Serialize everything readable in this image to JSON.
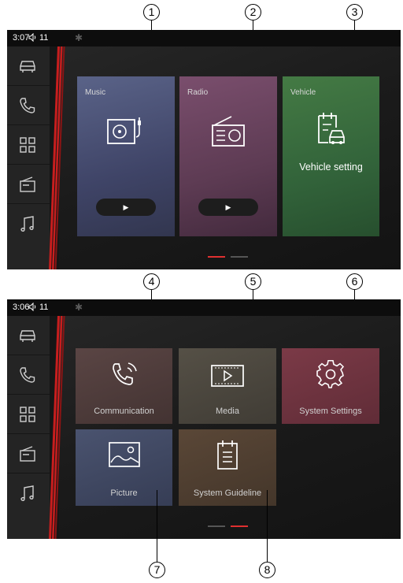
{
  "colors": {
    "accent_red": "#e03030",
    "inactive_dot": "#555555"
  },
  "callouts": [
    "1",
    "2",
    "3",
    "4",
    "5",
    "6",
    "7",
    "8"
  ],
  "screen1": {
    "status": {
      "time": "3:07",
      "volume": "11"
    },
    "sidebar": [
      {
        "icon": "car-icon"
      },
      {
        "icon": "phone-icon"
      },
      {
        "icon": "apps-grid-icon"
      },
      {
        "icon": "radio-icon"
      },
      {
        "icon": "music-note-icon"
      }
    ],
    "tiles": {
      "music": {
        "label": "Music",
        "icon": "turntable-icon",
        "play": "▶"
      },
      "radio": {
        "label": "Radio",
        "icon": "radio-icon",
        "play": "▶"
      },
      "vehicle": {
        "label": "Vehicle",
        "icon": "vehicle-clipboard-icon",
        "text": "Vehicle setting"
      }
    },
    "page_indicator": {
      "active": 1,
      "count": 2
    }
  },
  "screen2": {
    "status": {
      "time": "3:06",
      "volume": "11"
    },
    "tiles": {
      "communication": {
        "label": "Communication",
        "icon": "phone-call-icon"
      },
      "media": {
        "label": "Media",
        "icon": "media-player-icon"
      },
      "system_settings": {
        "label": "System Settings",
        "icon": "gear-icon"
      },
      "picture": {
        "label": "Picture",
        "icon": "picture-icon"
      },
      "system_guideline": {
        "label": "System Guideline",
        "icon": "clipboard-icon"
      }
    },
    "page_indicator": {
      "active": 2,
      "count": 2
    }
  }
}
